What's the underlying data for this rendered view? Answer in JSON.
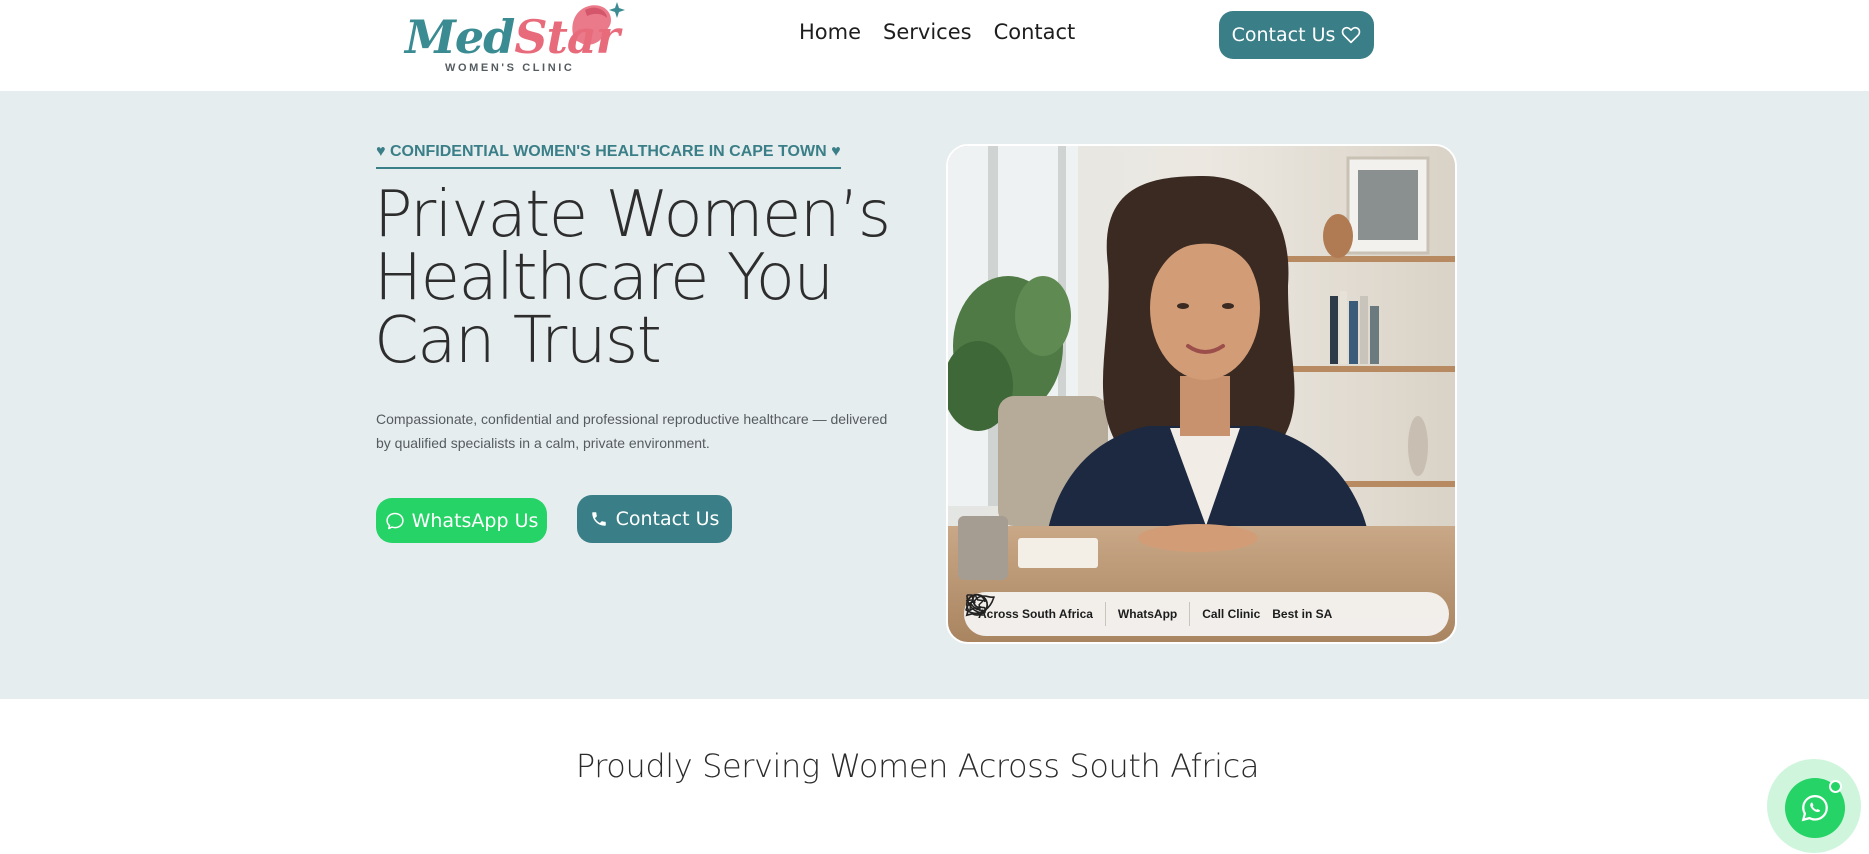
{
  "header": {
    "logo": {
      "brand_part1": "Med",
      "brand_part2": "Star",
      "tagline": "WOMEN'S CLINIC",
      "icon": "woman-profile-logo-icon"
    },
    "nav": [
      {
        "label": "Home"
      },
      {
        "label": "Services"
      },
      {
        "label": "Contact"
      }
    ],
    "contact_button": {
      "label": "Contact Us",
      "icon": "heart-outline-icon"
    }
  },
  "hero": {
    "eyebrow": "♥ CONFIDENTIAL WOMEN'S HEALTHCARE IN CAPE TOWN ♥",
    "title_lines": [
      "Private Women’s",
      "Healthcare You",
      "Can Trust"
    ],
    "description": "Compassionate, confidential and professional reproductive healthcare — delivered by qualified specialists in a calm, private environment.",
    "whatsapp_button": {
      "label": "WhatsApp Us",
      "icon": "chat-bubble-icon"
    },
    "contact_button": {
      "label": "Contact Us",
      "icon": "phone-icon"
    },
    "photo_badges": [
      {
        "label": "Across South Africa",
        "icon": "south-africa-map-icon"
      },
      {
        "label": "WhatsApp",
        "icon": "whatsapp-icon"
      },
      {
        "label": "Call Clinic",
        "icon": "phone-icon"
      },
      {
        "label": "Best in SA",
        "icon": "star-outline-icon"
      }
    ]
  },
  "section": {
    "title": "Proudly Serving Women Across South Africa"
  },
  "floating_whatsapp": {
    "icon": "whatsapp-icon"
  },
  "colors": {
    "teal": "#3a7f87",
    "whatsapp_green": "#25d366",
    "hero_bg": "#e6edef",
    "logo_pink": "#e86b7c"
  }
}
